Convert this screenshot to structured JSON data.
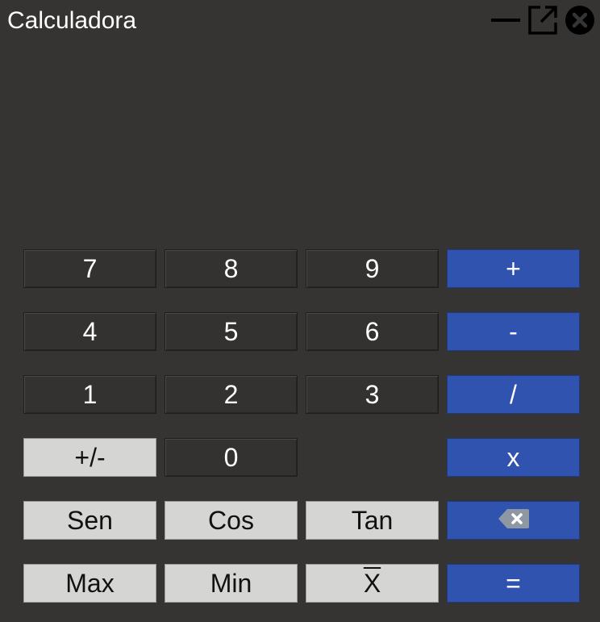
{
  "window": {
    "title": "Calculadora",
    "controls": [
      {
        "name": "minimize-icon"
      },
      {
        "name": "external-link-icon"
      },
      {
        "name": "close-icon"
      }
    ]
  },
  "display": {
    "value": ""
  },
  "keypad": {
    "rows": [
      [
        {
          "label": "7",
          "style": "num"
        },
        {
          "label": "8",
          "style": "num"
        },
        {
          "label": "9",
          "style": "num"
        },
        {
          "label": "+",
          "style": "op"
        }
      ],
      [
        {
          "label": "4",
          "style": "num"
        },
        {
          "label": "5",
          "style": "num"
        },
        {
          "label": "6",
          "style": "num"
        },
        {
          "label": "-",
          "style": "op"
        }
      ],
      [
        {
          "label": "1",
          "style": "num"
        },
        {
          "label": "2",
          "style": "num"
        },
        {
          "label": "3",
          "style": "num"
        },
        {
          "label": "/",
          "style": "op"
        }
      ],
      [
        {
          "label": "+/-",
          "style": "fn"
        },
        {
          "label": "0",
          "style": "num"
        },
        {
          "label": "",
          "style": "empty"
        },
        {
          "label": "x",
          "style": "op"
        }
      ],
      [
        {
          "label": "Sen",
          "style": "fn"
        },
        {
          "label": "Cos",
          "style": "fn"
        },
        {
          "label": "Tan",
          "style": "fn"
        },
        {
          "label": "",
          "style": "op",
          "icon": "backspace-icon"
        }
      ],
      [
        {
          "label": "Max",
          "style": "fn"
        },
        {
          "label": "Min",
          "style": "fn"
        },
        {
          "label": "X",
          "style": "fn",
          "overline": true
        },
        {
          "label": "=",
          "style": "op"
        }
      ]
    ]
  },
  "colors": {
    "background": "#353433",
    "operator": "#2f53ae",
    "function": "#d5d5d3",
    "number": "#333231"
  }
}
